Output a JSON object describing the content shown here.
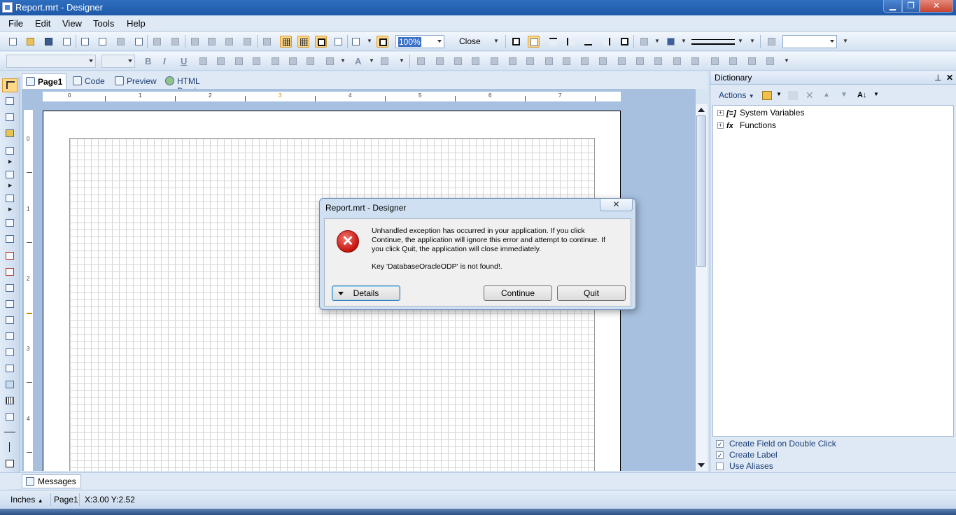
{
  "window": {
    "title": "Report.mrt - Designer",
    "min_glyph": "▁",
    "max_glyph": "❐",
    "close_glyph": "✕"
  },
  "menu": [
    "File",
    "Edit",
    "View",
    "Tools",
    "Help"
  ],
  "toolbar": {
    "zoom_value": "100%",
    "close_label": "Close"
  },
  "tabs": [
    {
      "label": "Page1",
      "active": true
    },
    {
      "label": "Code",
      "active": false
    },
    {
      "label": "Preview",
      "active": false
    },
    {
      "label": "HTML Preview",
      "active": false
    }
  ],
  "ruler": {
    "horizontal": [
      "0",
      "1",
      "2",
      "3",
      "4",
      "5",
      "6",
      "7"
    ],
    "vertical": [
      "0",
      "1",
      "2",
      "3",
      "4"
    ]
  },
  "dictionary": {
    "title": "Dictionary",
    "pin_glyph": "⊥",
    "close_glyph": "✕",
    "actions_label": "Actions",
    "sort_label": "A↓",
    "tree": [
      {
        "label": "System Variables",
        "icon": "variables-icon",
        "glyph": "[≡]",
        "expander": "+"
      },
      {
        "label": "Functions",
        "icon": "functions-icon",
        "glyph": "fx",
        "expander": "+"
      }
    ],
    "options": [
      {
        "label": "Create Field on Double Click",
        "checked": true
      },
      {
        "label": "Create Label",
        "checked": true
      },
      {
        "label": "Use Aliases",
        "checked": false
      }
    ],
    "check_mark": "✓"
  },
  "messages_tab": "Messages",
  "status": {
    "units": "Inches",
    "page": "Page1",
    "coords": "X:3.00  Y:2.52"
  },
  "dialog": {
    "title": "Report.mrt - Designer",
    "close_glyph": "✕",
    "icon_glyph": "✕",
    "message": "Unhandled exception has occurred in your application. If you click Continue, the application will ignore this error and attempt to continue. If you click Quit, the application will close immediately.",
    "detail": "Key 'DatabaseOracleODP' is not found!.",
    "details_label": "Details",
    "continue_label": "Continue",
    "quit_label": "Quit"
  },
  "colors": {
    "titlebar": "#1e58a8",
    "active_tool": "#ffd88a",
    "canvas_bg": "#a7c0e0",
    "error_red": "#c4120d"
  }
}
